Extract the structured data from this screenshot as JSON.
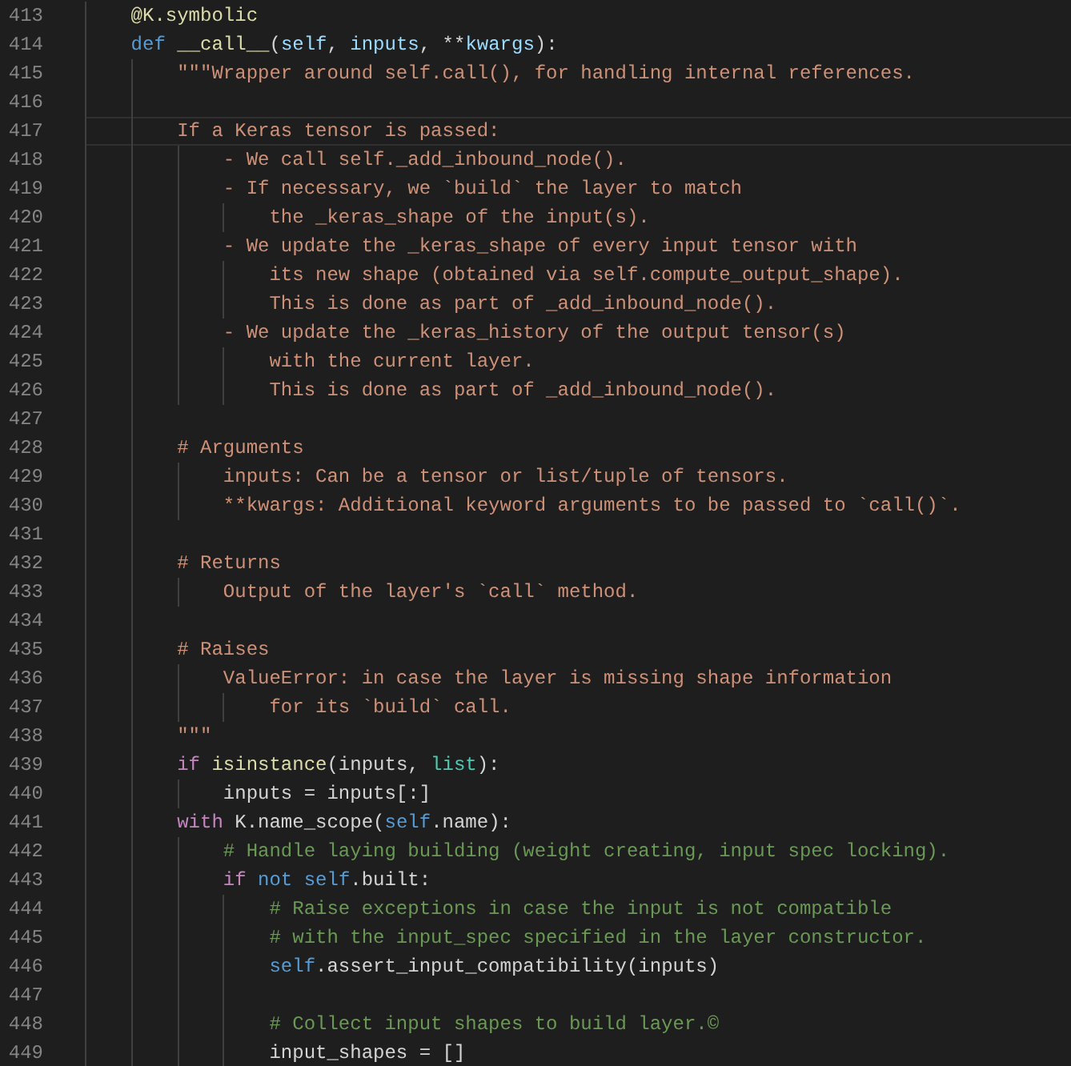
{
  "editor": {
    "lines": [
      {
        "number": "413",
        "selected": false,
        "tokens": [
          {
            "kind": "function",
            "text": "    @K.symbolic"
          }
        ]
      },
      {
        "number": "414",
        "selected": false,
        "tokens": [
          {
            "kind": "storage",
            "text": "    def"
          },
          {
            "kind": "function",
            "text": " __call__"
          },
          {
            "kind": "plain",
            "text": "("
          },
          {
            "kind": "param",
            "text": "self"
          },
          {
            "kind": "plain",
            "text": ", "
          },
          {
            "kind": "param",
            "text": "inputs"
          },
          {
            "kind": "plain",
            "text": ", **"
          },
          {
            "kind": "param",
            "text": "kwargs"
          },
          {
            "kind": "plain",
            "text": "):"
          }
        ]
      },
      {
        "number": "415",
        "selected": false,
        "tokens": [
          {
            "kind": "string",
            "text": "        \"\"\"Wrapper around self.call(), for handling internal references."
          }
        ]
      },
      {
        "number": "416",
        "selected": false
      },
      {
        "number": "417",
        "selected": true,
        "tokens": [
          {
            "kind": "string",
            "text": "        If a Keras tensor is passed:"
          }
        ]
      },
      {
        "number": "418",
        "selected": false,
        "tokens": [
          {
            "kind": "string",
            "text": "            - We call self._add_inbound_node()."
          }
        ]
      },
      {
        "number": "419",
        "selected": false,
        "tokens": [
          {
            "kind": "string",
            "text": "            - If necessary, we `build` the layer to match"
          }
        ]
      },
      {
        "number": "420",
        "selected": false,
        "tokens": [
          {
            "kind": "string",
            "text": "                the _keras_shape of the input(s)."
          }
        ]
      },
      {
        "number": "421",
        "selected": false,
        "tokens": [
          {
            "kind": "string",
            "text": "            - We update the _keras_shape of every input tensor with"
          }
        ]
      },
      {
        "number": "422",
        "selected": false,
        "tokens": [
          {
            "kind": "string",
            "text": "                its new shape (obtained via self.compute_output_shape)."
          }
        ]
      },
      {
        "number": "423",
        "selected": false,
        "tokens": [
          {
            "kind": "string",
            "text": "                This is done as part of _add_inbound_node()."
          }
        ]
      },
      {
        "number": "424",
        "selected": false,
        "tokens": [
          {
            "kind": "string",
            "text": "            - We update the _keras_history of the output tensor(s)"
          }
        ]
      },
      {
        "number": "425",
        "selected": false,
        "tokens": [
          {
            "kind": "string",
            "text": "                with the current layer."
          }
        ]
      },
      {
        "number": "426",
        "selected": false,
        "tokens": [
          {
            "kind": "string",
            "text": "                This is done as part of _add_inbound_node()."
          }
        ]
      },
      {
        "number": "427",
        "selected": false
      },
      {
        "number": "428",
        "selected": false,
        "tokens": [
          {
            "kind": "string",
            "text": "        # Arguments"
          }
        ]
      },
      {
        "number": "429",
        "selected": false,
        "tokens": [
          {
            "kind": "string",
            "text": "            inputs: Can be a tensor or list/tuple of tensors."
          }
        ]
      },
      {
        "number": "430",
        "selected": false,
        "tokens": [
          {
            "kind": "string",
            "text": "            **kwargs: Additional keyword arguments to be passed to `call()`."
          }
        ]
      },
      {
        "number": "431",
        "selected": false
      },
      {
        "number": "432",
        "selected": false,
        "tokens": [
          {
            "kind": "string",
            "text": "        # Returns"
          }
        ]
      },
      {
        "number": "433",
        "selected": false,
        "tokens": [
          {
            "kind": "string",
            "text": "            Output of the layer's `call` method."
          }
        ]
      },
      {
        "number": "434",
        "selected": false
      },
      {
        "number": "435",
        "selected": false,
        "tokens": [
          {
            "kind": "string",
            "text": "        # Raises"
          }
        ]
      },
      {
        "number": "436",
        "selected": false,
        "tokens": [
          {
            "kind": "string",
            "text": "            ValueError: in case the layer is missing shape information"
          }
        ]
      },
      {
        "number": "437",
        "selected": false,
        "tokens": [
          {
            "kind": "string",
            "text": "                for its `build` call."
          }
        ]
      },
      {
        "number": "438",
        "selected": false,
        "tokens": [
          {
            "kind": "string",
            "text": "        \"\"\""
          }
        ]
      },
      {
        "number": "439",
        "selected": false,
        "tokens": [
          {
            "kind": "control",
            "text": "        if"
          },
          {
            "kind": "function",
            "text": " isinstance"
          },
          {
            "kind": "plain",
            "text": "(inputs, "
          },
          {
            "kind": "builtin",
            "text": "list"
          },
          {
            "kind": "plain",
            "text": "):"
          }
        ]
      },
      {
        "number": "440",
        "selected": false,
        "tokens": [
          {
            "kind": "plain",
            "text": "            inputs = inputs[:]"
          }
        ]
      },
      {
        "number": "441",
        "selected": false,
        "tokens": [
          {
            "kind": "control",
            "text": "        with"
          },
          {
            "kind": "plain",
            "text": " K.name_scope("
          },
          {
            "kind": "storage",
            "text": "self"
          },
          {
            "kind": "plain",
            "text": ".name):"
          }
        ]
      },
      {
        "number": "442",
        "selected": false,
        "tokens": [
          {
            "kind": "comment",
            "text": "            # Handle laying building (weight creating, input spec locking)."
          }
        ]
      },
      {
        "number": "443",
        "selected": false,
        "tokens": [
          {
            "kind": "control",
            "text": "            if"
          },
          {
            "kind": "storage",
            "text": " not self"
          },
          {
            "kind": "plain",
            "text": ".built:"
          }
        ]
      },
      {
        "number": "444",
        "selected": false,
        "tokens": [
          {
            "kind": "comment",
            "text": "                # Raise exceptions in case the input is not compatible"
          }
        ]
      },
      {
        "number": "445",
        "selected": false,
        "tokens": [
          {
            "kind": "comment",
            "text": "                # with the input_spec specified in the layer constructor."
          }
        ]
      },
      {
        "number": "446",
        "selected": false,
        "tokens": [
          {
            "kind": "storage",
            "text": "                self"
          },
          {
            "kind": "plain",
            "text": ".assert_input_compatibility(inputs)"
          }
        ]
      },
      {
        "number": "447",
        "selected": false
      },
      {
        "number": "448",
        "selected": false,
        "tokens": [
          {
            "kind": "comment",
            "text": "                # Collect input shapes to build layer.©"
          }
        ]
      },
      {
        "number": "449",
        "selected": false,
        "tokens": [
          {
            "kind": "plain",
            "text": "                input_shapes = []"
          }
        ]
      }
    ]
  }
}
